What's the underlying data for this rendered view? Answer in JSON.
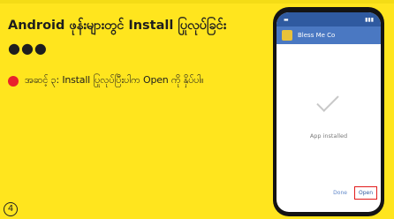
{
  "slide": {
    "title": "Android ဖုန်းများတွင် Install ပြုလုပ်ခြင်း",
    "dots": "●●●",
    "step_text": "အဆင့် ၃: Install ပြုလုပ်ပြီးပါက Open ကို နှိပ်ပါ။",
    "corner_label": "4"
  },
  "phone": {
    "toolbar_title": "Bless Me Co",
    "status_message": "App installed",
    "done_label": "Done",
    "open_label": "Open"
  },
  "colors": {
    "background": "#ffe51e",
    "bullet": "#e8212c",
    "phone_header": "#4a78c2",
    "highlight_box": "#e21b1b"
  }
}
